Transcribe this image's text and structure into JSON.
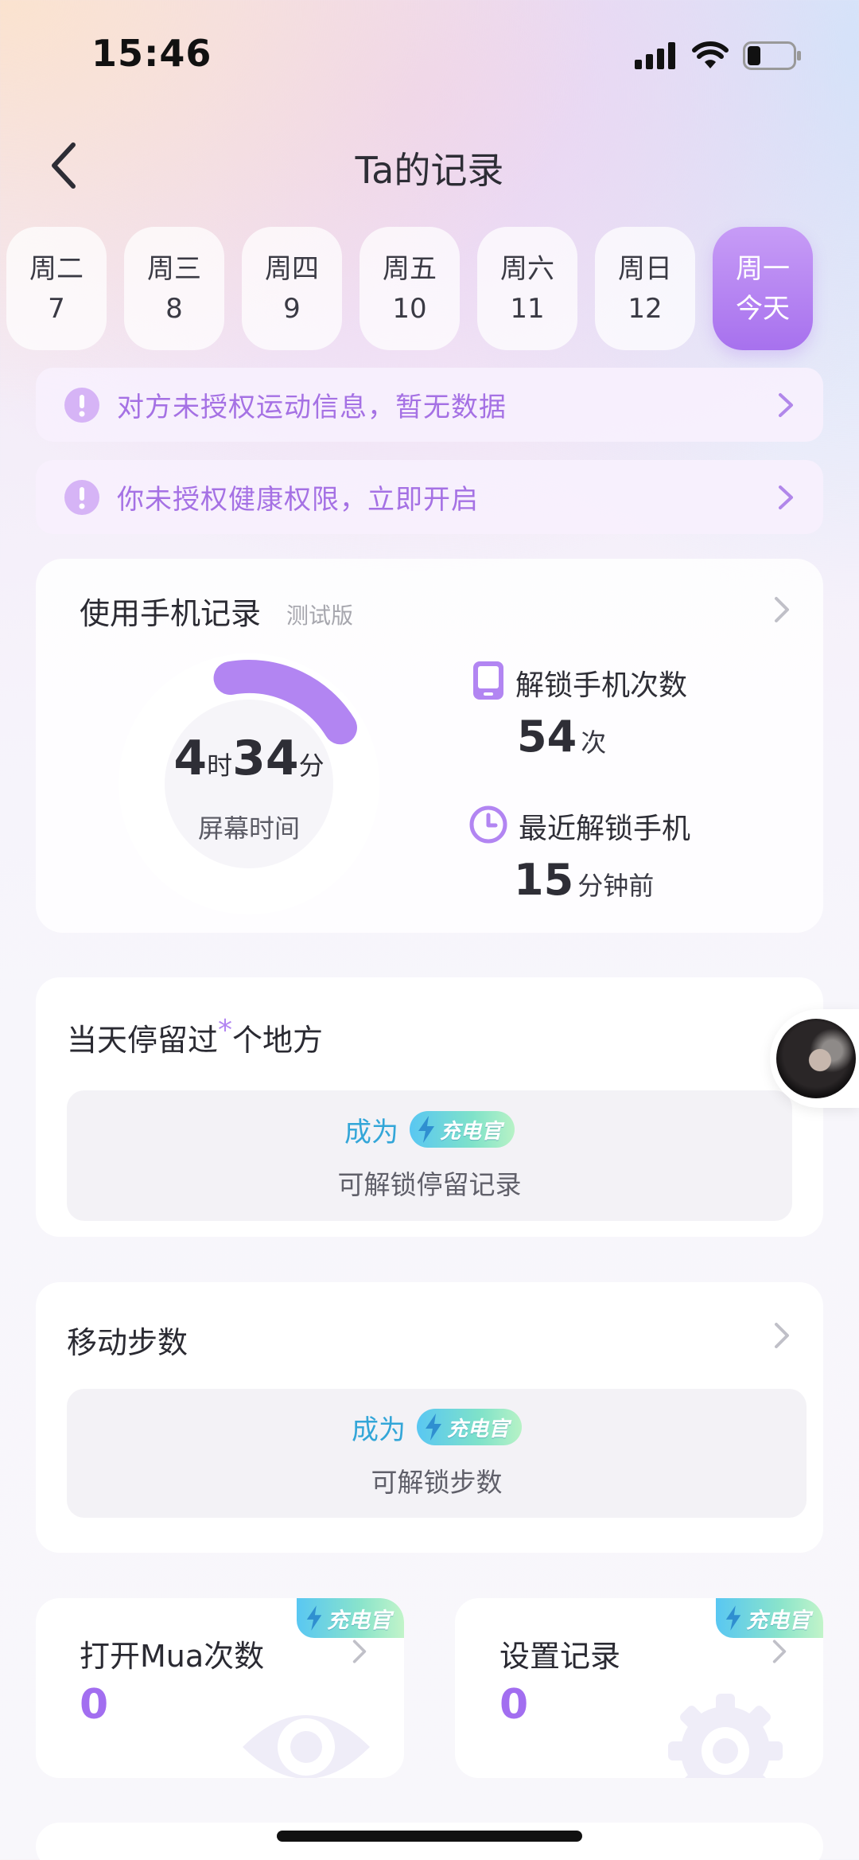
{
  "status_bar": {
    "time": "15:46"
  },
  "nav": {
    "title": "Ta的记录"
  },
  "dates": [
    {
      "weekday": "周二",
      "day": "7",
      "active": false
    },
    {
      "weekday": "周三",
      "day": "8",
      "active": false
    },
    {
      "weekday": "周四",
      "day": "9",
      "active": false
    },
    {
      "weekday": "周五",
      "day": "10",
      "active": false
    },
    {
      "weekday": "周六",
      "day": "11",
      "active": false
    },
    {
      "weekday": "周日",
      "day": "12",
      "active": false
    },
    {
      "weekday": "周一",
      "day": "今天",
      "active": true
    }
  ],
  "alerts": [
    {
      "text": "对方未授权运动信息，暂无数据"
    },
    {
      "text": "你未授权健康权限，立即开启"
    }
  ],
  "usage": {
    "title": "使用手机记录",
    "subtitle": "测试版",
    "screen_hours": "4",
    "hour_unit": "时",
    "screen_minutes": "34",
    "minute_unit": "分",
    "screen_label": "屏幕时间",
    "screen_progress": 0.19,
    "accent_color": "#b285f2",
    "unlock_label": "解锁手机次数",
    "unlock_count": "54",
    "unlock_unit": "次",
    "recent_label": "最近解锁手机",
    "recent_value": "15",
    "recent_unit": "分钟前"
  },
  "places": {
    "title_part1": "当天停留过",
    "title_star": "*",
    "title_part2": "个地方",
    "become": "成为",
    "badge": "充电官",
    "unlock_text": "可解锁停留记录"
  },
  "steps": {
    "title": "移动步数",
    "become": "成为",
    "badge": "充电官",
    "unlock_text": "可解锁步数"
  },
  "mua": {
    "title": "打开Mua次数",
    "value": "0",
    "badge": "充电官"
  },
  "settings_record": {
    "title": "设置记录",
    "value": "0",
    "badge": "充电官"
  }
}
